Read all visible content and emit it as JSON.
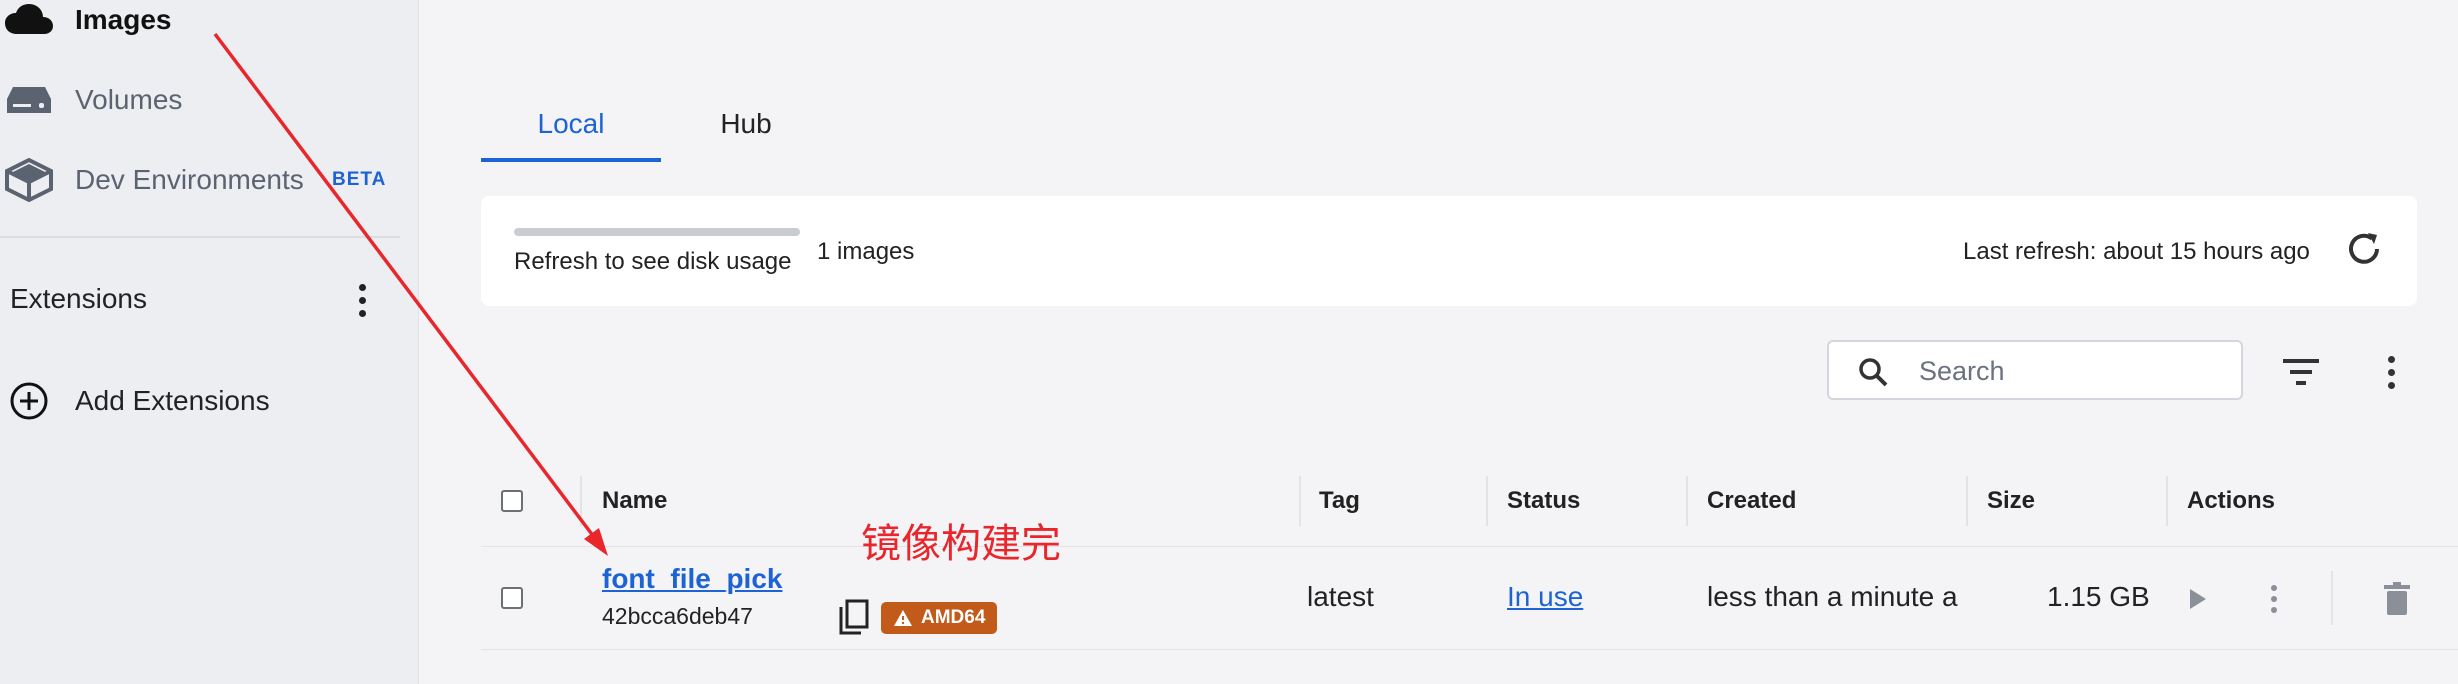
{
  "sidebar": {
    "items": [
      {
        "label": "Images",
        "icon": "cloud-icon",
        "active": true
      },
      {
        "label": "Volumes",
        "icon": "drive-icon",
        "active": false
      },
      {
        "label": "Dev Environments",
        "icon": "box-icon",
        "active": false,
        "badge": "BETA"
      }
    ],
    "extensions_title": "Extensions",
    "add_extensions_label": "Add Extensions"
  },
  "tabs": [
    {
      "label": "Local",
      "active": true
    },
    {
      "label": "Hub",
      "active": false
    }
  ],
  "summary": {
    "disk_usage_label": "Refresh to see disk usage",
    "images_count": "1 images",
    "last_refresh": "Last refresh: about 15 hours ago"
  },
  "search": {
    "placeholder": "Search",
    "value": ""
  },
  "table": {
    "columns": [
      "Name",
      "Tag",
      "Status",
      "Created",
      "Size",
      "Actions"
    ],
    "rows": [
      {
        "name": "font_file_pick",
        "id": "42bcca6deb47",
        "arch": "AMD64",
        "tag": "latest",
        "status": "In use",
        "created": "less than a minute a",
        "size": "1.15 GB"
      }
    ]
  },
  "annotation": {
    "text": "镜像构建完",
    "color": "#e8262c"
  },
  "colors": {
    "accent": "#1d63d3",
    "arch_badge": "#c25a1a",
    "sidebar_bg": "#eceef2",
    "page_bg": "#f4f4f6"
  }
}
